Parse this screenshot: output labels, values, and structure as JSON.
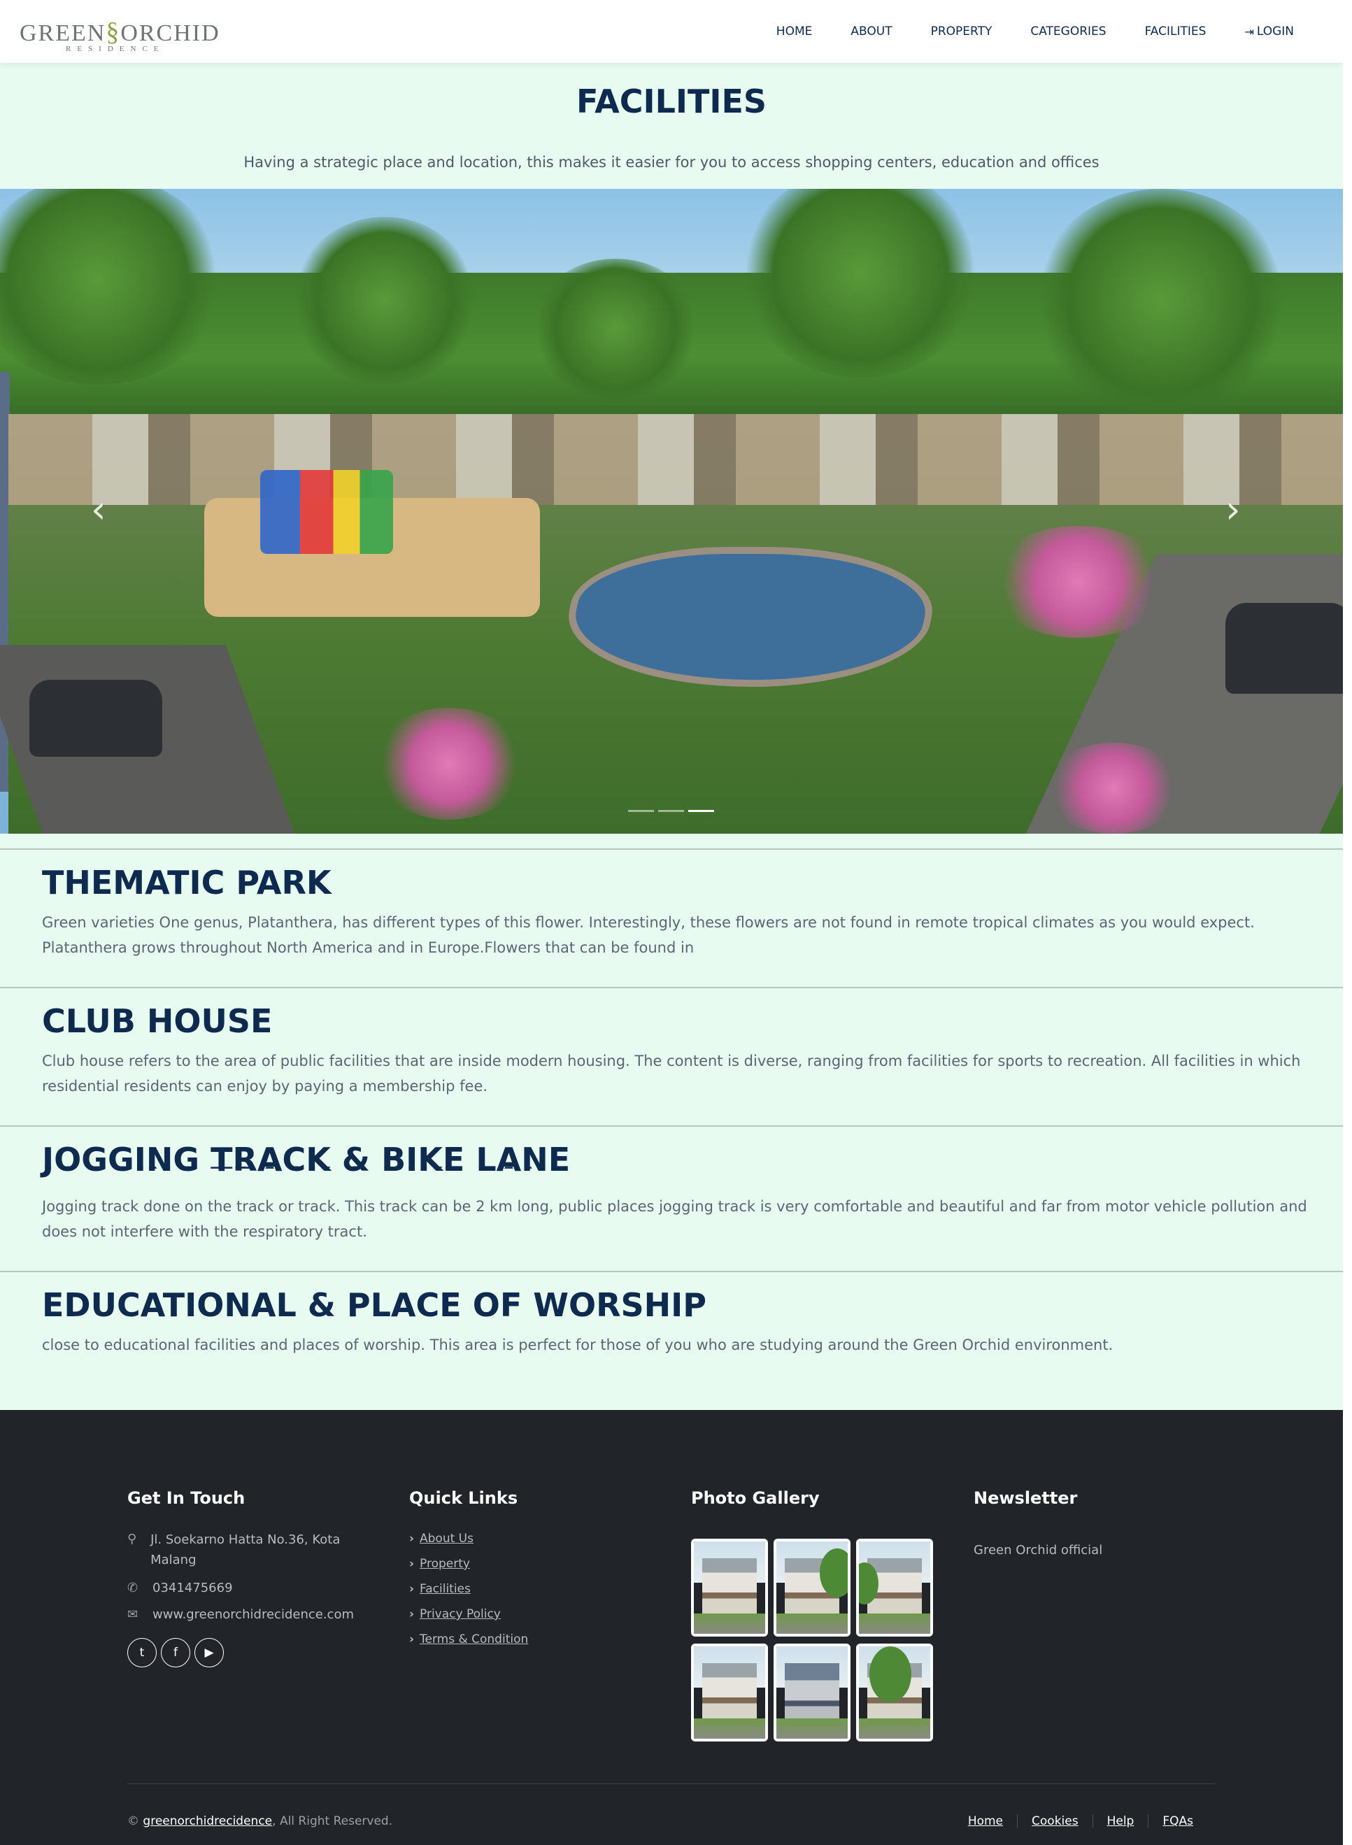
{
  "brand": {
    "logo_main": "GREEN",
    "logo_swirl": "§",
    "logo_main2": "ORCHID",
    "logo_sub": "RESIDENCE"
  },
  "nav": {
    "items": [
      "HOME",
      "ABOUT",
      "PROPERTY",
      "CATEGORIES",
      "FACILITIES",
      "LOGIN"
    ]
  },
  "page": {
    "title": "FACILITIES",
    "subtitle": "Having a strategic place and location, this makes it easier for you to access shopping centers, education and offices"
  },
  "carousel": {
    "prev_label": "‹",
    "next_label": "›",
    "active_slide": 3,
    "slide_count": 3
  },
  "facilities": [
    {
      "title": "THEMATIC PARK",
      "text": "Green varieties One genus, Platanthera, has different types of this flower. Interestingly, these flowers are not found in remote tropical climates as you would expect. Platanthera grows throughout North America and in Europe.Flowers that can be found in"
    },
    {
      "title": "CLUB HOUSE",
      "text": "Club house refers to the area of public facilities that are inside modern housing. The content is diverse, ranging from facilities for sports to recreation. All facilities in which residential residents can enjoy by paying a membership fee."
    },
    {
      "title": "JOGGING TRACK & BIKE LANE",
      "text": "Jogging track done on the track or track. This track can be 2 km long, public places jogging track is very comfortable and beautiful and far from motor vehicle pollution and does not interfere with the respiratory tract."
    },
    {
      "title": "EDUCATIONAL & PLACE OF WORSHIP",
      "text": "close to educational facilities and places of worship. This area is perfect for those of you who are studying around the Green Orchid environment."
    }
  ],
  "footer": {
    "contact": {
      "heading": "Get In Touch",
      "address": "Jl. Soekarno Hatta No.36, Kota Malang",
      "phone": "0341475669",
      "website": "www.greenorchidrecidence.com",
      "social_icons": [
        "twitter-icon",
        "facebook-icon",
        "youtube-icon"
      ]
    },
    "quick_links": {
      "heading": "Quick Links",
      "items": [
        "About Us",
        "Property",
        "Facilities",
        "Privacy Policy",
        "Terms & Condition"
      ]
    },
    "gallery": {
      "heading": "Photo Gallery",
      "count": 6
    },
    "newsletter": {
      "heading": "Newsletter",
      "text": "Green Orchid official"
    },
    "copyright_prefix": "©",
    "copyright_link": "greenorchidrecidence",
    "copyright_suffix": ", All Right Reserved.",
    "bottom_links": [
      "Home",
      "Cookies",
      "Help",
      "FQAs"
    ]
  },
  "colors": {
    "navy": "#0f2a4f",
    "mint_bg": "#e8fbf1",
    "footer_bg": "#212428",
    "logo_accent": "#8ea140"
  }
}
